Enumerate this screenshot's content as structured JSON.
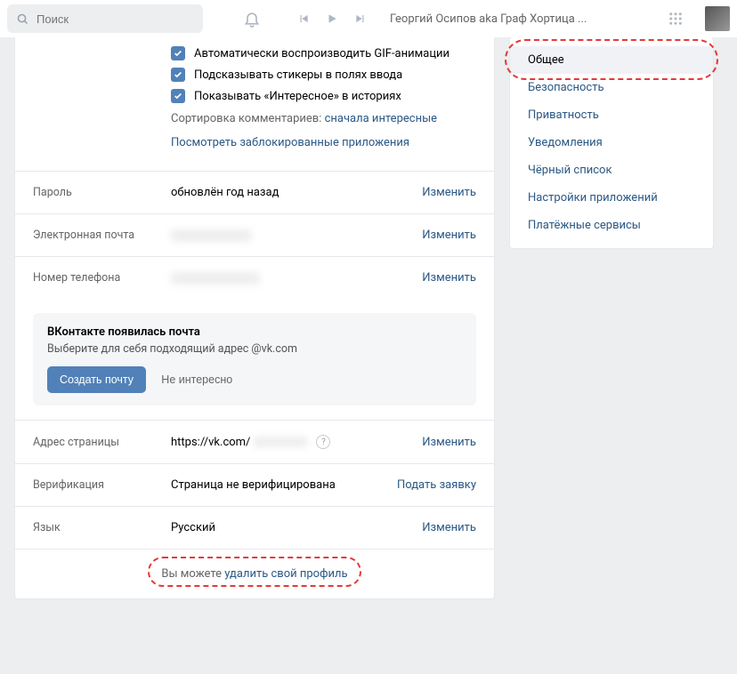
{
  "topbar": {
    "search_placeholder": "Поиск",
    "track_title": "Георгий Осипов aka Граф Хортица ..."
  },
  "checkboxes": {
    "gif": "Автоматически воспроизводить GIF-анимации",
    "stickers": "Подсказывать стикеры в полях ввода",
    "stories": "Показывать «Интересное» в историях"
  },
  "sort": {
    "label": "Сортировка комментариев: ",
    "value": "сначала интересные"
  },
  "blocked_link": "Посмотреть заблокированные приложения",
  "rows": {
    "password": {
      "label": "Пароль",
      "value": "обновлён год назад",
      "action": "Изменить"
    },
    "email": {
      "label": "Электронная почта",
      "action": "Изменить"
    },
    "phone": {
      "label": "Номер телефона",
      "action": "Изменить"
    },
    "address": {
      "label": "Адрес страницы",
      "prefix": "https://vk.com/",
      "action": "Изменить"
    },
    "verify": {
      "label": "Верификация",
      "value": "Страница не верифицирована",
      "action": "Подать заявку"
    },
    "lang": {
      "label": "Язык",
      "value": "Русский",
      "action": "Изменить"
    }
  },
  "mailbox": {
    "title": "ВКонтакте появилась почта",
    "desc": "Выберите для себя подходящий адрес @vk.com",
    "create": "Создать почту",
    "dismiss": "Не интересно"
  },
  "footer": {
    "prefix": "Вы можете ",
    "link": "удалить свой профиль"
  },
  "sidebar": {
    "items": [
      "Общее",
      "Безопасность",
      "Приватность",
      "Уведомления",
      "Чёрный список",
      "Настройки приложений",
      "Платёжные сервисы"
    ]
  }
}
